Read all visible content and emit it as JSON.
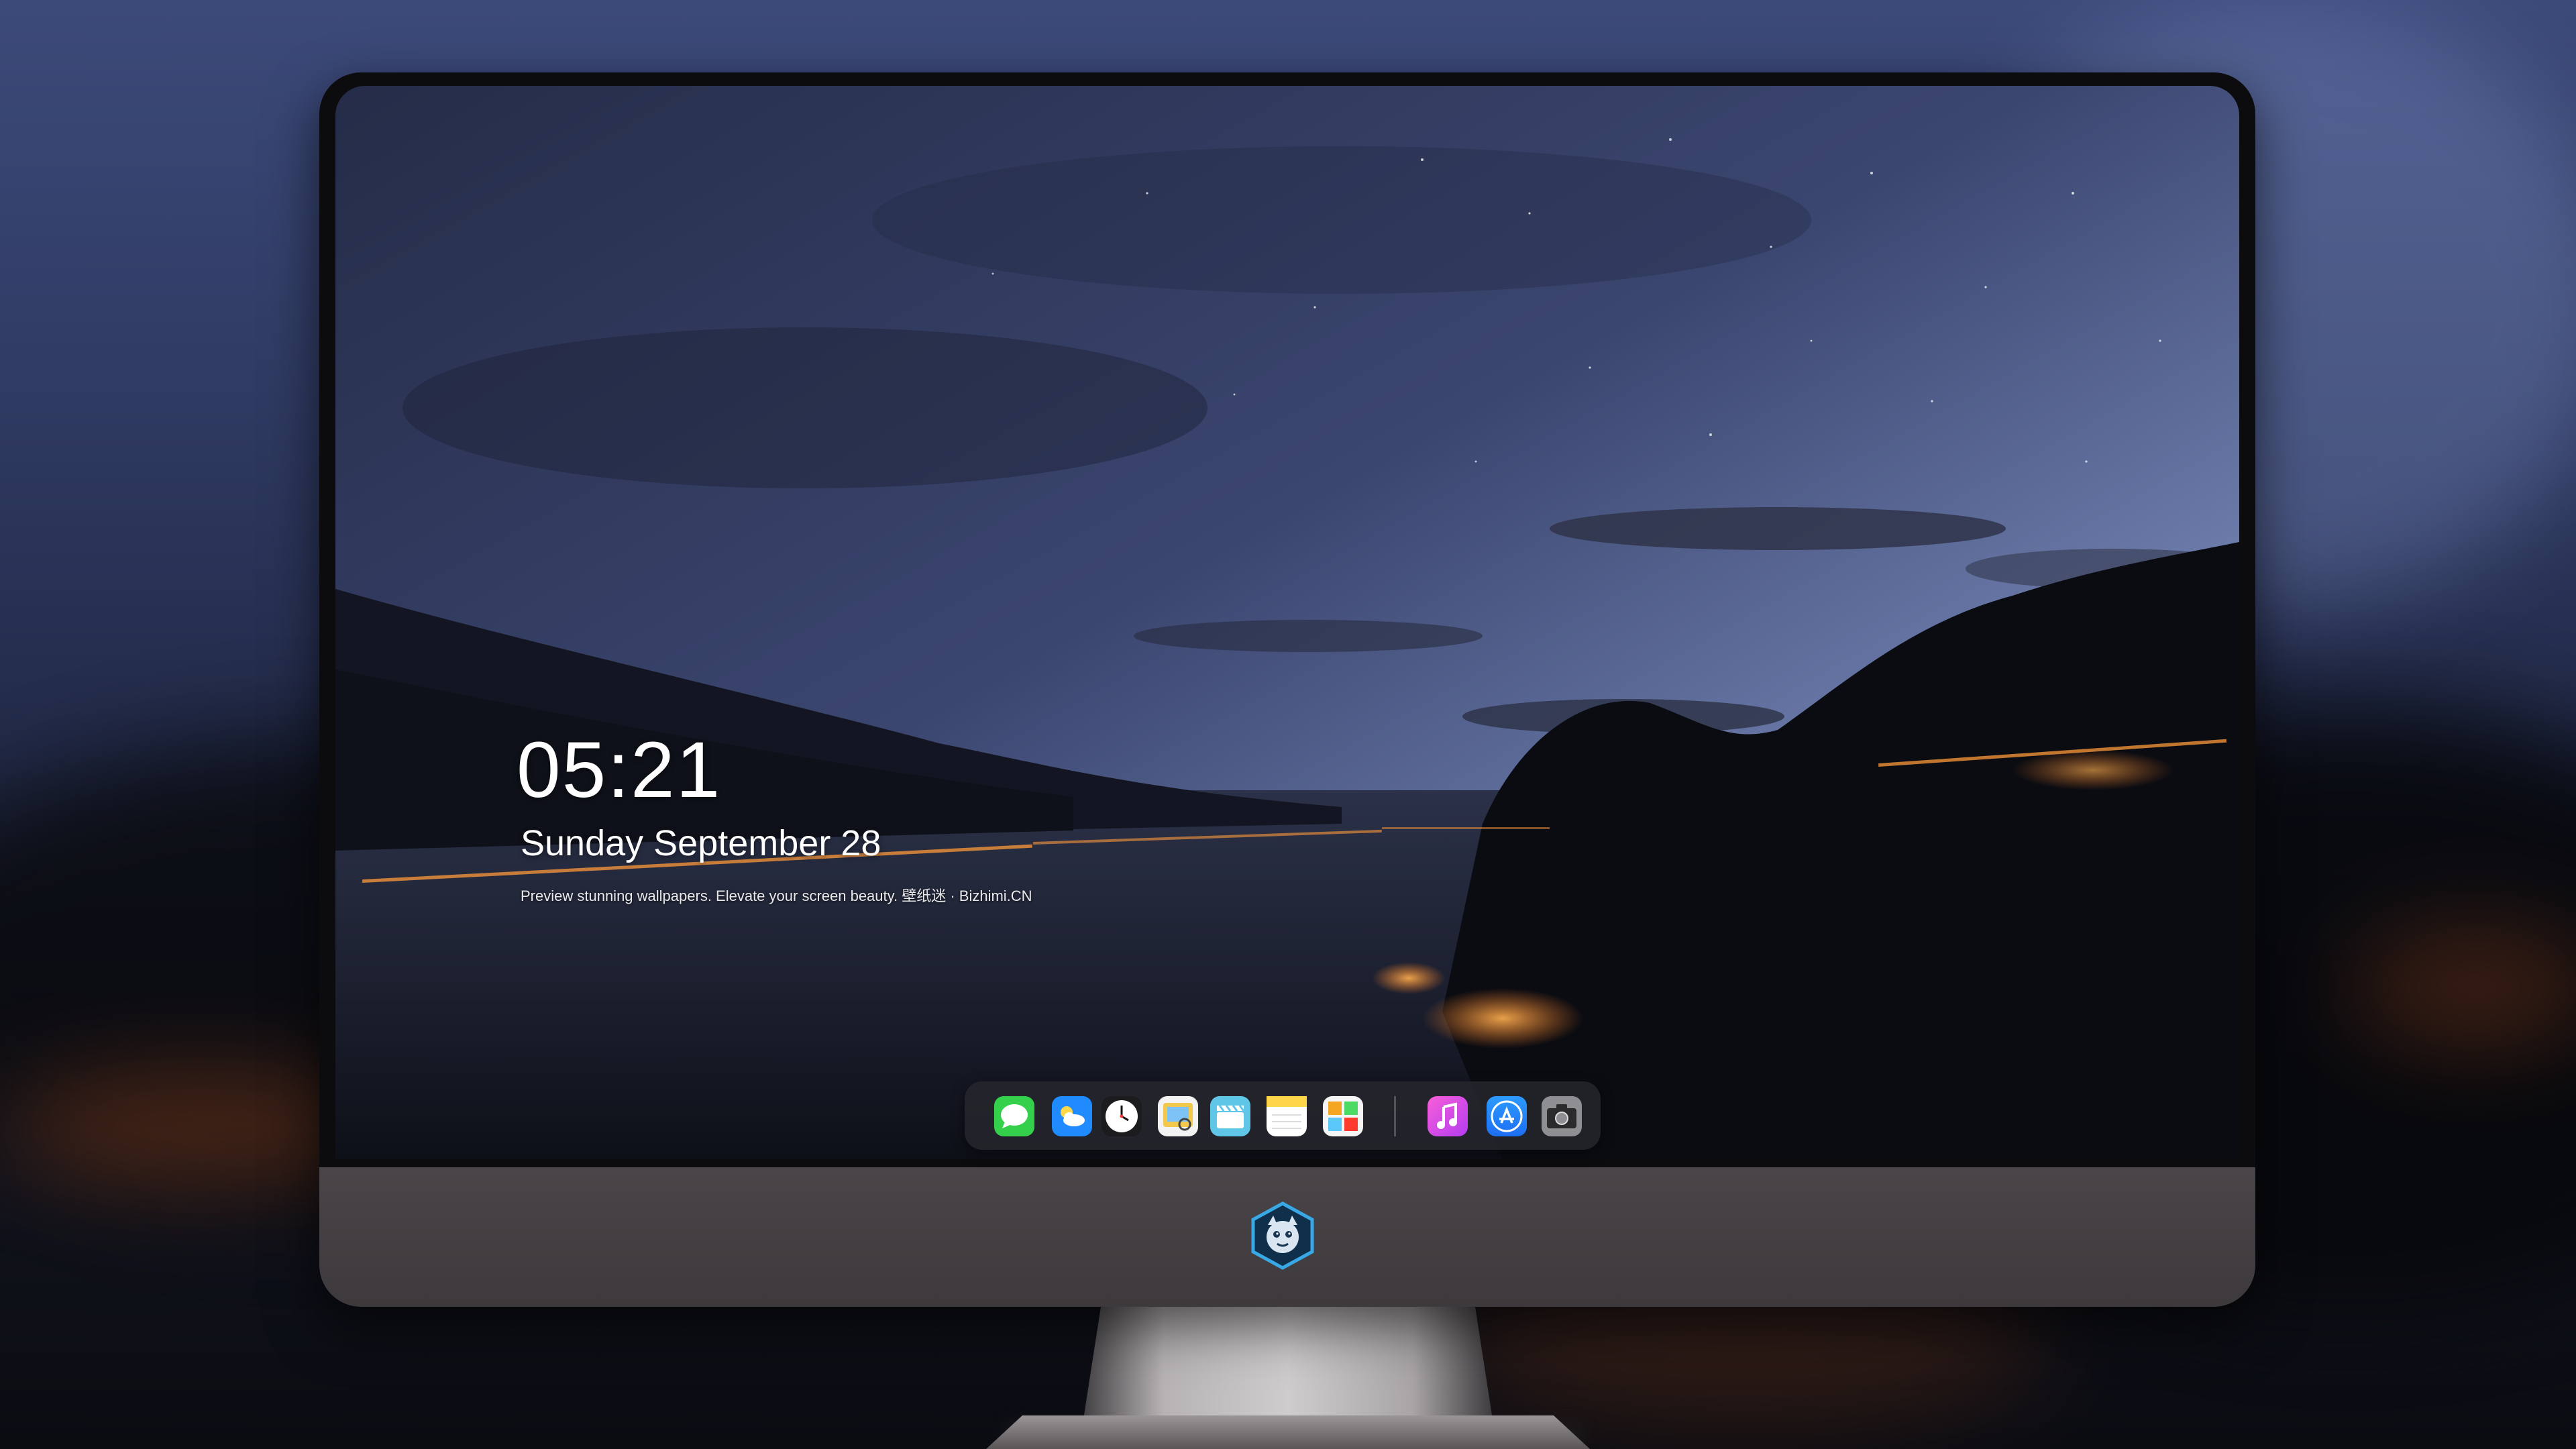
{
  "lockscreen": {
    "time": "05:21",
    "date": "Sunday September  28",
    "caption": "Preview stunning wallpapers. Elevate your screen beauty. 壁纸迷 · Bizhimi.CN"
  },
  "dock": {
    "apps": [
      {
        "icon": "messages-icon",
        "color": "#35d04b"
      },
      {
        "icon": "weather-icon",
        "color": "#1f8bff"
      },
      {
        "icon": "clock-icon",
        "color": "#ffffff"
      },
      {
        "icon": "preview-icon",
        "color": "#f2c94c"
      },
      {
        "icon": "clips-icon",
        "color": "#5fc6e8"
      },
      {
        "icon": "notes-icon",
        "color": "#ffd54a"
      },
      {
        "icon": "photo-booth-icon",
        "color": "#f5a623"
      },
      {
        "icon": "music-icon",
        "color": "#e83fd6"
      },
      {
        "icon": "app-store-icon",
        "color": "#1d7cf2"
      },
      {
        "icon": "camera-icon",
        "color": "#8e8e93"
      }
    ]
  },
  "monitor": {
    "chin_logo": "dragon-mascot-icon"
  }
}
